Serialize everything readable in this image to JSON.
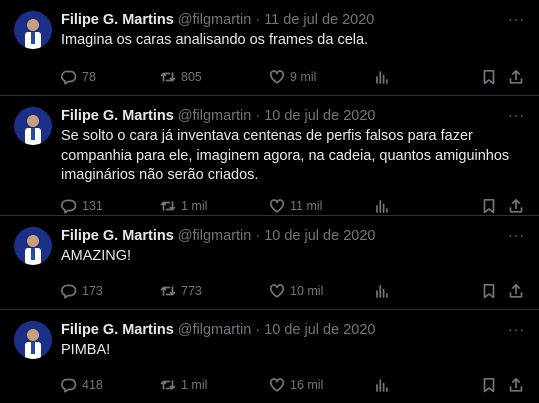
{
  "colors": {
    "background": "#000000",
    "text": "#e7e9ea",
    "muted": "#71767b",
    "divider": "#2f3336"
  },
  "icons": {
    "reply": "speech-bubble-icon",
    "retweet": "retweet-icon",
    "like": "heart-icon",
    "views": "bar-chart-icon",
    "bookmark": "bookmark-icon",
    "share": "share-upload-icon",
    "more": "more-dots-icon"
  },
  "more_glyph": "···",
  "separator": "·",
  "tweets": [
    {
      "name": "Filipe G. Martins",
      "handle": "@filgmartin",
      "date": "11 de jul de 2020",
      "text": "Imagina os caras analisando os frames da cela.",
      "replies": "78",
      "retweets": "805",
      "likes": "9 mil"
    },
    {
      "name": "Filipe G. Martins",
      "handle": "@filgmartin",
      "date": "10 de jul de 2020",
      "text": "Se solto o cara já inventava centenas de perfis falsos para fazer companhia para ele, imaginem agora, na cadeia, quantos amiguinhos imaginários não serão criados.",
      "replies": "131",
      "retweets": "1 mil",
      "likes": "11 mil"
    },
    {
      "name": "Filipe G. Martins",
      "handle": "@filgmartin",
      "date": "10 de jul de 2020",
      "text": "AMAZING!",
      "replies": "173",
      "retweets": "773",
      "likes": "10 mil"
    },
    {
      "name": "Filipe G. Martins",
      "handle": "@filgmartin",
      "date": "10 de jul de 2020",
      "text": "PIMBA!",
      "replies": "418",
      "retweets": "1 mil",
      "likes": "16 mil"
    }
  ]
}
